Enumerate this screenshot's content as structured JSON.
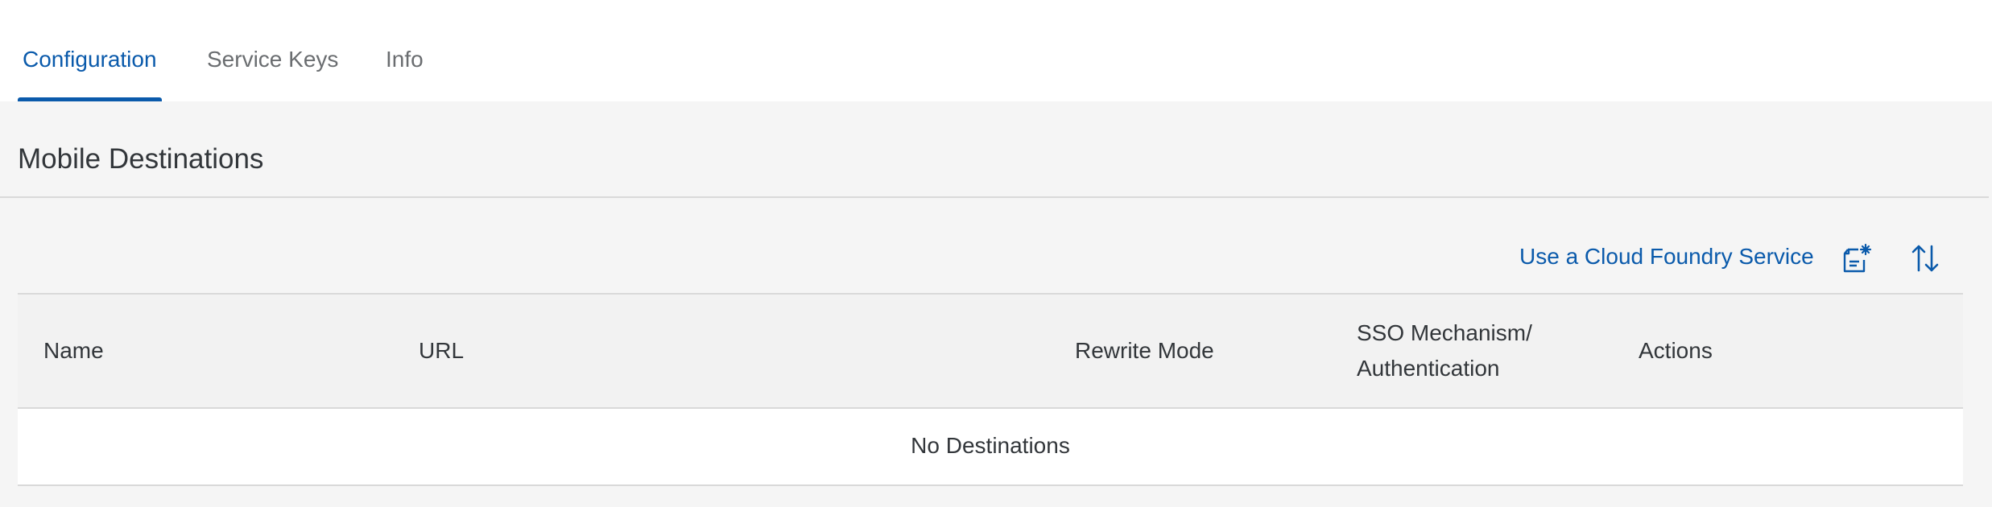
{
  "tabs": [
    {
      "label": "Configuration",
      "selected": true
    },
    {
      "label": "Service Keys",
      "selected": false
    },
    {
      "label": "Info",
      "selected": false
    }
  ],
  "section": {
    "title": "Mobile Destinations"
  },
  "toolbar": {
    "link_label": "Use a Cloud Foundry Service",
    "icons": [
      "new-document-icon",
      "sort-icon"
    ]
  },
  "table": {
    "columns": [
      "Name",
      "URL",
      "Rewrite Mode",
      "SSO Mechanism/",
      "Authentication",
      "Actions"
    ],
    "empty_text": "No Destinations"
  },
  "colors": {
    "accent": "#0a5aab",
    "background": "#f5f5f5",
    "header_background": "#f2f2f2"
  }
}
